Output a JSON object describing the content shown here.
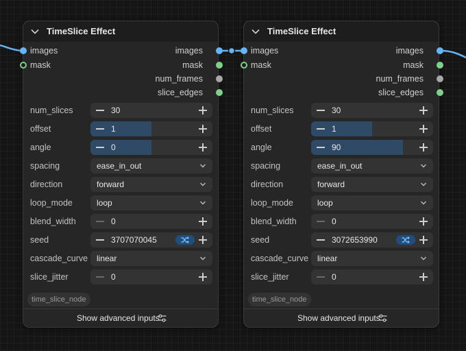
{
  "nodes": [
    {
      "title": "TimeSlice Effect",
      "inputs": [
        {
          "label": "images",
          "color": "blue"
        },
        {
          "label": "mask",
          "color": "green"
        }
      ],
      "outputs": [
        {
          "label": "images",
          "color": "blue"
        },
        {
          "label": "mask",
          "color": "green"
        },
        {
          "label": "num_frames",
          "color": "gray"
        },
        {
          "label": "slice_edges",
          "color": "green"
        }
      ],
      "widgets": [
        {
          "label": "num_slices",
          "value": "30",
          "type": "number"
        },
        {
          "label": "offset",
          "value": "1",
          "type": "slider",
          "fill_fraction": 0.5
        },
        {
          "label": "angle",
          "value": "0",
          "type": "slider",
          "fill_fraction": 0.5
        },
        {
          "label": "spacing",
          "value": "ease_in_out",
          "type": "combo"
        },
        {
          "label": "direction",
          "value": "forward",
          "type": "combo"
        },
        {
          "label": "loop_mode",
          "value": "loop",
          "type": "combo"
        },
        {
          "label": "blend_width",
          "value": "0",
          "type": "number",
          "at_min": true
        },
        {
          "label": "seed",
          "value": "3707070045",
          "type": "number",
          "randomize": true
        },
        {
          "label": "cascade_curve",
          "value": "linear",
          "type": "combo"
        },
        {
          "label": "slice_jitter",
          "value": "0",
          "type": "number",
          "at_min": true
        }
      ],
      "node_tag": "time_slice_node",
      "advanced_label": "Show advanced inputs"
    },
    {
      "title": "TimeSlice Effect",
      "inputs": [
        {
          "label": "images",
          "color": "blue"
        },
        {
          "label": "mask",
          "color": "green"
        }
      ],
      "outputs": [
        {
          "label": "images",
          "color": "blue"
        },
        {
          "label": "mask",
          "color": "green"
        },
        {
          "label": "num_frames",
          "color": "gray"
        },
        {
          "label": "slice_edges",
          "color": "green"
        }
      ],
      "widgets": [
        {
          "label": "num_slices",
          "value": "30",
          "type": "number"
        },
        {
          "label": "offset",
          "value": "1",
          "type": "slider",
          "fill_fraction": 0.5
        },
        {
          "label": "angle",
          "value": "90",
          "type": "slider",
          "fill_fraction": 0.75
        },
        {
          "label": "spacing",
          "value": "ease_in_out",
          "type": "combo"
        },
        {
          "label": "direction",
          "value": "forward",
          "type": "combo"
        },
        {
          "label": "loop_mode",
          "value": "loop",
          "type": "combo"
        },
        {
          "label": "blend_width",
          "value": "0",
          "type": "number",
          "at_min": true
        },
        {
          "label": "seed",
          "value": "3072653990",
          "type": "number",
          "randomize": true
        },
        {
          "label": "cascade_curve",
          "value": "linear",
          "type": "combo"
        },
        {
          "label": "slice_jitter",
          "value": "0",
          "type": "number",
          "at_min": true
        }
      ],
      "node_tag": "time_slice_node",
      "advanced_label": "Show advanced inputs"
    }
  ],
  "colors": {
    "blue": "#64b5f6",
    "green": "#7ed18b",
    "gray": "#a8a8a8",
    "slider_fill": "#2f4a66",
    "link": "#64b5f6"
  }
}
